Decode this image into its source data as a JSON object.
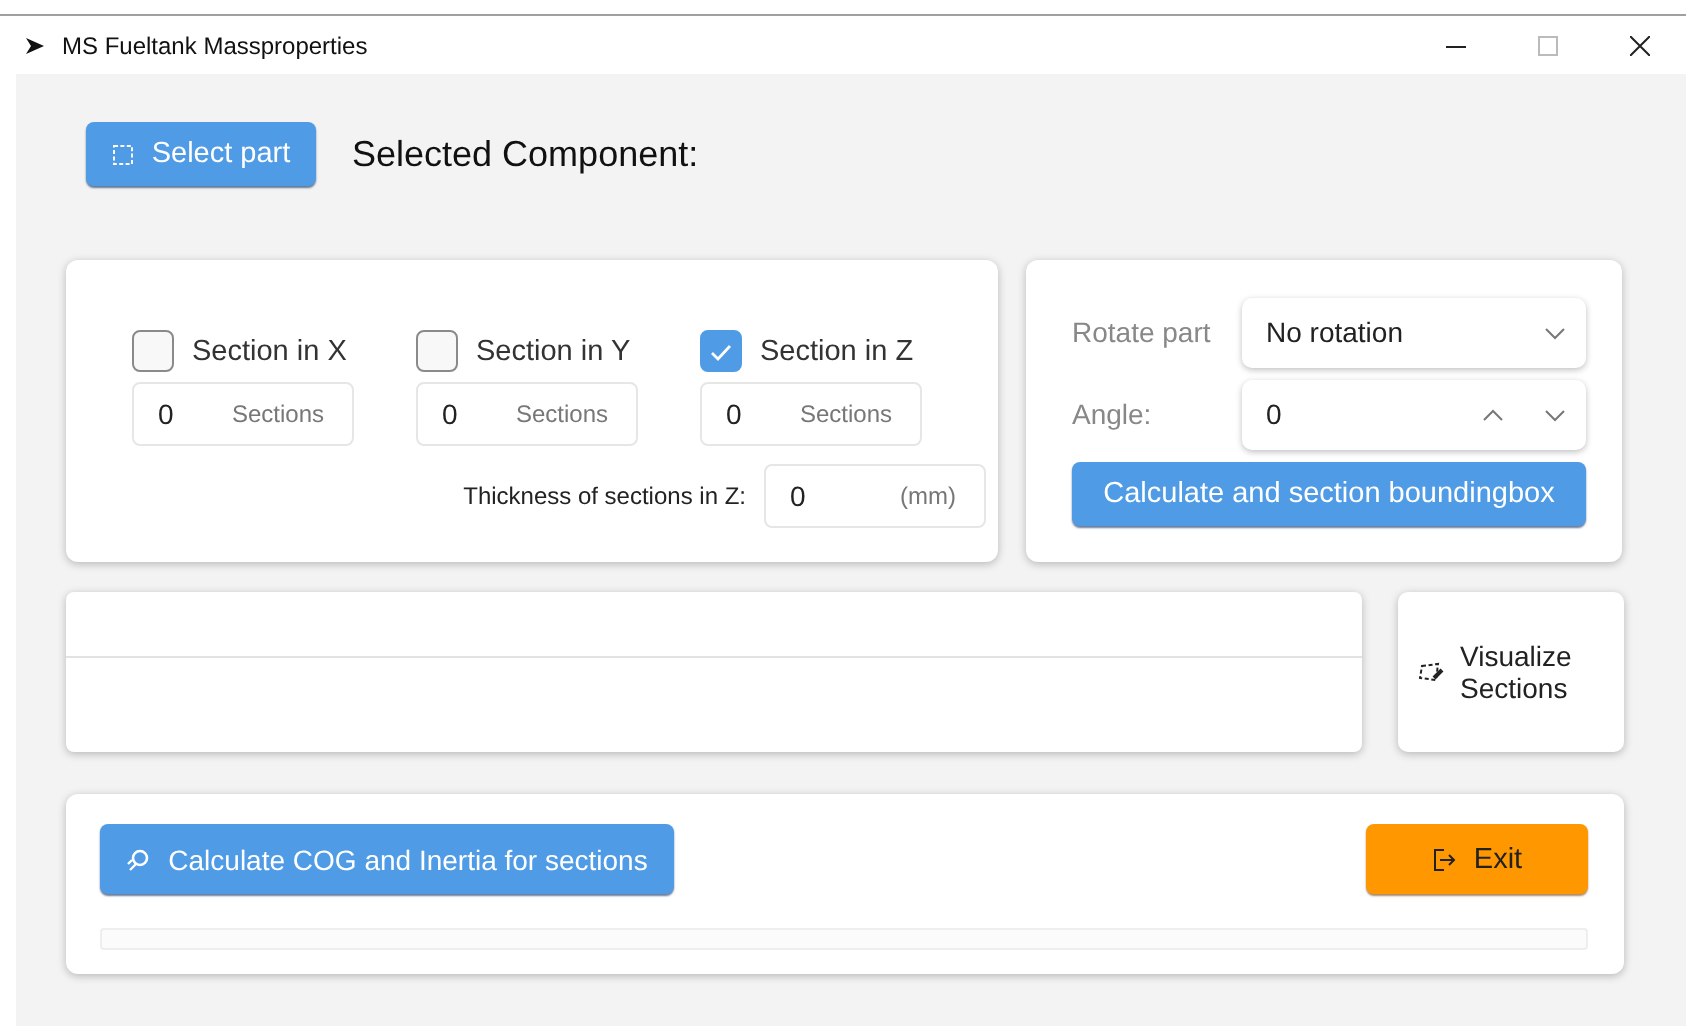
{
  "window": {
    "title": "MS Fueltank Massproperties"
  },
  "select_button": {
    "label": "Select part"
  },
  "selected_component": {
    "label": "Selected Component:"
  },
  "sections": [
    {
      "label": "Section in X",
      "checked": false,
      "value": "0",
      "unit": "Sections"
    },
    {
      "label": "Section in Y",
      "checked": false,
      "value": "0",
      "unit": "Sections"
    },
    {
      "label": "Section in Z",
      "checked": true,
      "value": "0",
      "unit": "Sections"
    }
  ],
  "thickness": {
    "label": "Thickness of sections in Z:",
    "value": "0",
    "unit": "(mm)"
  },
  "rotate": {
    "label": "Rotate part",
    "value": "No rotation"
  },
  "angle": {
    "label": "Angle:",
    "value": "0"
  },
  "bbox_button": {
    "label": "Calculate and section boundingbox"
  },
  "visualize_button": {
    "label": "Visualize Sections"
  },
  "cog_button": {
    "label": "Calculate COG and Inertia for sections"
  },
  "exit_button": {
    "label": "Exit"
  },
  "progress": {
    "level": 0
  }
}
